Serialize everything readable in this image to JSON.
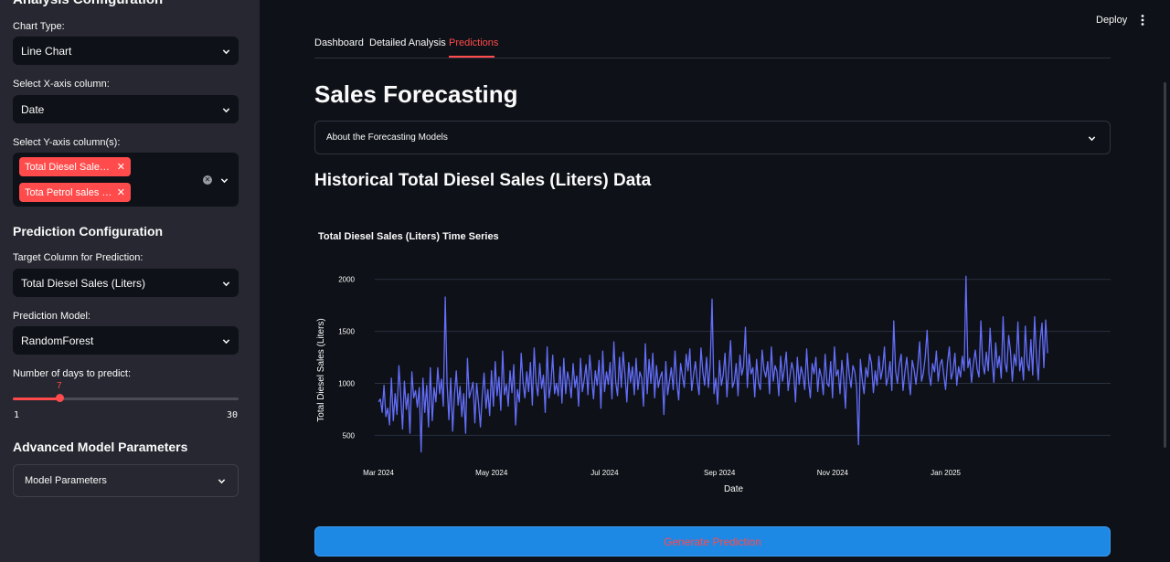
{
  "sidebar": {
    "analysis_title": "Analysis Configuration",
    "chart_type_label": "Chart Type:",
    "chart_type_value": "Line Chart",
    "x_axis_label": "Select X-axis column:",
    "x_axis_value": "Date",
    "y_axis_label": "Select Y-axis column(s):",
    "y_axis_tags": [
      "Total Diesel Sales (Liters)",
      "Tota Petrol sales (Liters)"
    ],
    "y_axis_tags_display": [
      "Total Diesel Sale…",
      "Tota Petrol sales …"
    ],
    "prediction_title": "Prediction Configuration",
    "target_label": "Target Column for Prediction:",
    "target_value": "Total Diesel Sales (Liters)",
    "model_label": "Prediction Model:",
    "model_value": "RandomForest",
    "days_label": "Number of days to predict:",
    "days_slider": {
      "value": 7,
      "min": 1,
      "max": 30,
      "value_text": "7",
      "min_text": "1",
      "max_text": "30"
    },
    "advanced_title": "Advanced Model Parameters",
    "model_params_label": "Model Parameters"
  },
  "header": {
    "deploy_label": "Deploy"
  },
  "tabs": [
    {
      "label": "Dashboard",
      "active": false
    },
    {
      "label": "Detailed Analysis",
      "active": false
    },
    {
      "label": "Predictions",
      "active": true
    }
  ],
  "main": {
    "title": "Sales Forecasting",
    "about_expander": "About the Forecasting Models",
    "historical_title": "Historical Total Diesel Sales (Liters) Data",
    "generate_button": "Generate Prediction"
  },
  "colors": {
    "accent": "#ff4b4b",
    "line": "#636efa",
    "button": "#1e88e5",
    "sidebar": "#262730",
    "background": "#0e1117"
  },
  "chart_data": {
    "type": "line",
    "title": "Total Diesel Sales (Liters) Time Series",
    "xlabel": "Date",
    "ylabel": "Total Diesel Sales (Liters)",
    "x_range": [
      "2024-02-28",
      "2025-03-31"
    ],
    "ylim": [
      380,
      2050
    ],
    "y_ticks": [
      500,
      1000,
      1500,
      2000
    ],
    "x_ticks": [
      {
        "date": "2024-03-01",
        "label": "Mar 2024"
      },
      {
        "date": "2024-05-01",
        "label": "May 2024"
      },
      {
        "date": "2024-07-01",
        "label": "Jul 2024"
      },
      {
        "date": "2024-09-01",
        "label": "Sep 2024"
      },
      {
        "date": "2024-11-01",
        "label": "Nov 2024"
      },
      {
        "date": "2025-01-01",
        "label": "Jan 2025"
      }
    ],
    "grid": true,
    "series": [
      {
        "x_start": "2024-03-01",
        "x_step_days": 1,
        "values": [
          820,
          850,
          720,
          980,
          680,
          760,
          600,
          1050,
          640,
          900,
          700,
          1170,
          880,
          560,
          1020,
          750,
          900,
          520,
          1110,
          860,
          930,
          770,
          960,
          340,
          1050,
          720,
          980,
          580,
          1150,
          640,
          960,
          820,
          1150,
          900,
          1040,
          780,
          1830,
          1000,
          650,
          1050,
          540,
          890,
          1120,
          790,
          970,
          680,
          900,
          520,
          1240,
          860,
          930,
          1010,
          620,
          1000,
          800,
          580,
          880,
          1100,
          760,
          940,
          690,
          1120,
          780,
          1210,
          880,
          1060,
          740,
          1310,
          890,
          990,
          780,
          1120,
          910,
          1180,
          600,
          940,
          820,
          1290,
          1010,
          860,
          1110,
          920,
          1200,
          790,
          1340,
          1010,
          880,
          1190,
          950,
          1080,
          720,
          1350,
          860,
          980,
          1270,
          900,
          1000,
          880,
          1160,
          810,
          1240,
          900,
          1110,
          1020,
          860,
          1190,
          960,
          1070,
          780,
          1240,
          920,
          1030,
          1180,
          890,
          1270,
          1060,
          850,
          1120,
          980,
          1220,
          760,
          1310,
          920,
          1110,
          990,
          1200,
          850,
          1400,
          1010,
          880,
          1250,
          960,
          1300,
          1090,
          820,
          1200,
          1010,
          1160,
          890,
          1240,
          940,
          1110,
          1050,
          780,
          1380,
          900,
          1230,
          1000,
          1290,
          860,
          1170,
          960,
          1060,
          1110,
          700,
          1210,
          890,
          1020,
          1150,
          940,
          1310,
          1000,
          840,
          1190,
          1070,
          960,
          1280,
          1120,
          1330,
          930,
          1080,
          1210,
          1020,
          890,
          1340,
          1110,
          980,
          1250,
          960,
          1180,
          1810,
          900,
          1050,
          800,
          1220,
          980,
          1080,
          1290,
          870,
          1150,
          1410,
          960,
          1020,
          1190,
          880,
          1270,
          1080,
          1160,
          1540,
          960,
          1280,
          1090,
          1150,
          870,
          1230,
          1010,
          940,
          1320,
          1130,
          1060,
          1210,
          900,
          1350,
          1020,
          1170,
          1110,
          880,
          1260,
          1020,
          1140,
          1300,
          930,
          1070,
          1200,
          1110,
          820,
          1250,
          990,
          1160,
          1080,
          940,
          1330,
          1020,
          860,
          1190,
          1090,
          1250,
          920,
          1140,
          1060,
          890,
          1280,
          1000,
          970,
          1210,
          860,
          1350,
          1070,
          1130,
          900,
          1220,
          1040,
          760,
          1290,
          1080,
          960,
          1170,
          1110,
          960,
          410,
          1230,
          1030,
          900,
          1150,
          1060,
          1280,
          1190,
          910,
          1120,
          980,
          1260,
          1040,
          1140,
          1350,
          980,
          1060,
          1210,
          930,
          1600,
          1120,
          1000,
          1180,
          1280,
          930,
          1100,
          1250,
          1050,
          890,
          1220,
          1130,
          990,
          1170,
          1400,
          1020,
          1100,
          1250,
          1510,
          1090,
          980,
          1190,
          1110,
          1310,
          1020,
          1180,
          1230,
          1080,
          940,
          1200,
          1350,
          1040,
          1110,
          1290,
          980,
          1160,
          1060,
          1260,
          1120,
          2030,
          1150,
          1240,
          1010,
          1190,
          1320,
          1140,
          1060,
          1600,
          1190,
          1090,
          1300,
          1120,
          1530,
          1230,
          1010,
          1390,
          1150,
          1260,
          1050,
          1640,
          1200,
          1110,
          1460,
          1310,
          1020,
          1280,
          1170,
          1590,
          1120,
          1250,
          1030,
          1550,
          1190,
          1120,
          1420,
          1080,
          1640,
          1260,
          1030,
          1410,
          1580,
          1150,
          1610,
          1290
        ]
      }
    ]
  }
}
